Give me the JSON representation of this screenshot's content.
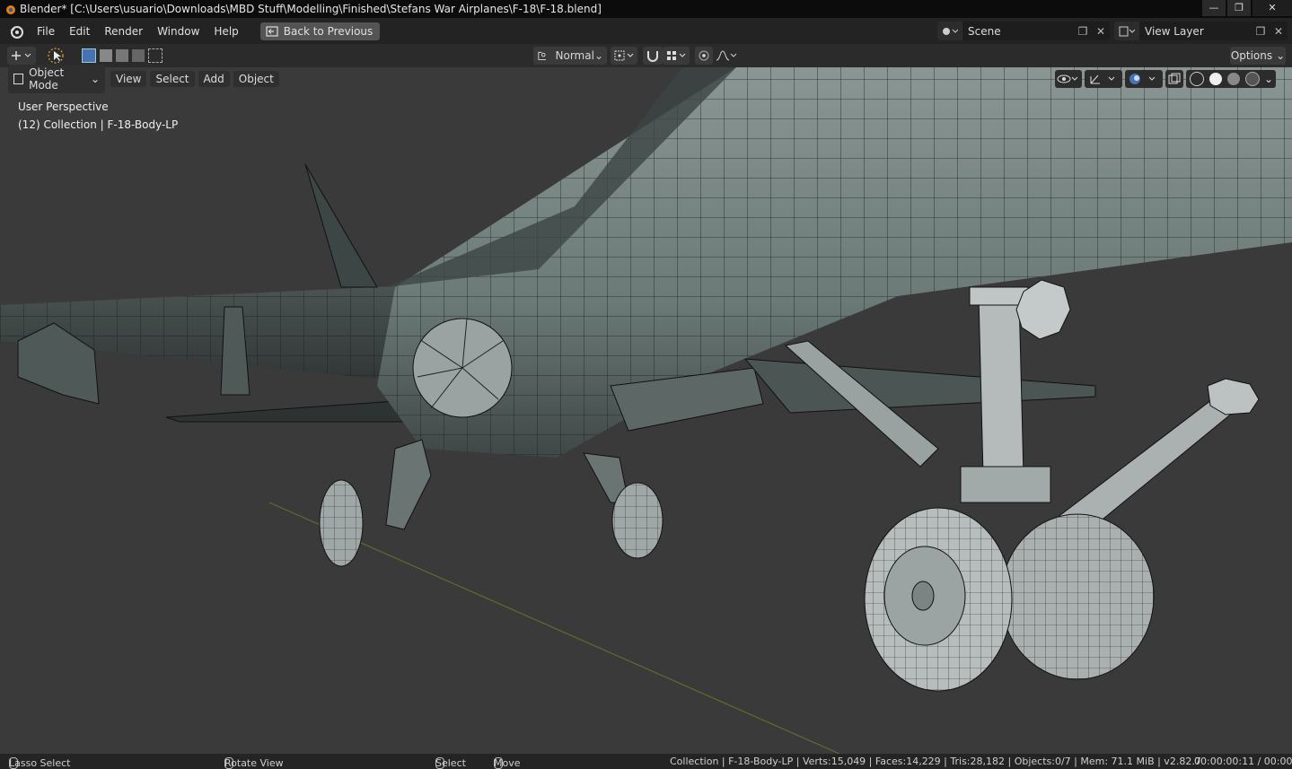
{
  "titlebar": {
    "title": "Blender* [C:\\Users\\usuario\\Downloads\\MBD Stuff\\Modelling\\Finished\\Stefans War Airplanes\\F-18\\F-18.blend]",
    "minimize": "—",
    "maximize": "❐",
    "close": "✕"
  },
  "menubar": {
    "items": [
      "File",
      "Edit",
      "Render",
      "Window",
      "Help"
    ],
    "back_button": "Back to Previous",
    "scene": "Scene",
    "view_layer": "View Layer"
  },
  "header": {
    "orientation": "Normal",
    "options": "Options"
  },
  "viewport": {
    "mode": "Object Mode",
    "menus": [
      "View",
      "Select",
      "Add",
      "Object"
    ],
    "perspective": "User Perspective",
    "collection_info": "(12) Collection | F-18-Body-LP"
  },
  "statusbar": {
    "lasso": "Lasso Select",
    "rotate": "Rotate View",
    "select": "Select",
    "move": "Move",
    "stats": "Collection | F-18-Body-LP | Verts:15,049 | Faces:14,229 | Tris:28,182 | Objects:0/7 | Mem: 71.1 MiB | v2.82.7",
    "time": "00:00:00:11 / 00:00:"
  },
  "colors": {
    "accent": "#4772b3",
    "background": "#303030",
    "viewport": "#3a3a3a"
  }
}
